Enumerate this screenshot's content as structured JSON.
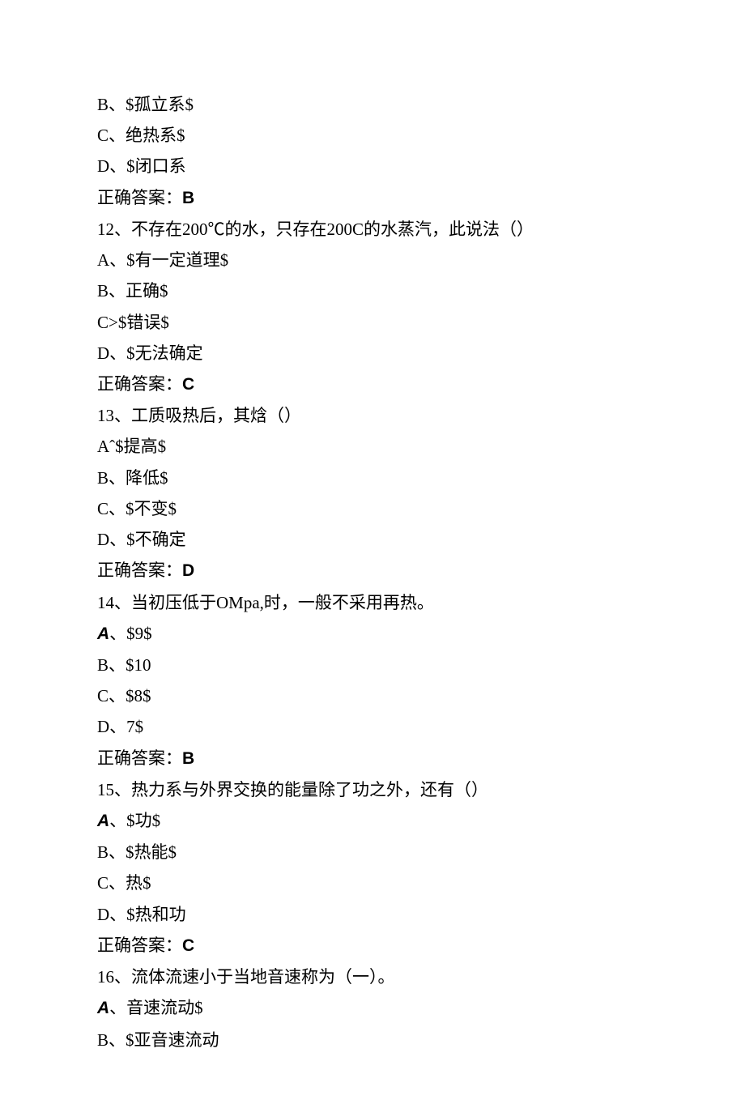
{
  "lines": [
    {
      "cls": "",
      "text": "B、$孤立系$"
    },
    {
      "cls": "",
      "text": "C、绝热系$"
    },
    {
      "cls": "",
      "text": "D、$闭口系"
    },
    {
      "cls": "",
      "prefix": "正确答案：",
      "boldClass": "bold",
      "bold": "B"
    },
    {
      "cls": "",
      "text": "12、不存在200℃的水，只存在200C的水蒸汽，此说法（）"
    },
    {
      "cls": "",
      "text": "A、$有一定道理$"
    },
    {
      "cls": "",
      "text": "B、正确$"
    },
    {
      "cls": "",
      "text": "C>$错误$"
    },
    {
      "cls": "",
      "text": "D、$无法确定"
    },
    {
      "cls": "",
      "prefix": "正确答案：",
      "boldClass": "bold",
      "bold": "C"
    },
    {
      "cls": "",
      "text": "13、工质吸热后，其焓（）"
    },
    {
      "cls": "",
      "text": "Aˆ$提高$"
    },
    {
      "cls": "",
      "text": "B、降低$"
    },
    {
      "cls": "",
      "text": "C、$不变$"
    },
    {
      "cls": "",
      "text": "D、$不确定"
    },
    {
      "cls": "",
      "prefix": "正确答案：",
      "boldClass": "bold",
      "bold": "D"
    },
    {
      "cls": "",
      "text": "14、当初压低于OMpa,时，一般不采用再热。"
    },
    {
      "cls": "",
      "boldPrefixClass": "italic-bold",
      "boldPrefix": "A",
      "text": "、$9$"
    },
    {
      "cls": "",
      "text": "B、$10"
    },
    {
      "cls": "",
      "text": "C、$8$"
    },
    {
      "cls": "",
      "text": "D、7$"
    },
    {
      "cls": "",
      "prefix": "正确答案：",
      "boldClass": "bold",
      "bold": "B"
    },
    {
      "cls": "",
      "text": "15、热力系与外界交换的能量除了功之外，还有（）"
    },
    {
      "cls": "",
      "boldPrefixClass": "italic-bold",
      "boldPrefix": "A",
      "text": "、$功$"
    },
    {
      "cls": "",
      "text": "B、$热能$"
    },
    {
      "cls": "",
      "text": "C、热$"
    },
    {
      "cls": "",
      "text": "D、$热和功"
    },
    {
      "cls": "",
      "prefix": "正确答案：",
      "boldClass": "bold",
      "bold": "C"
    },
    {
      "cls": "",
      "text": "16、流体流速小于当地音速称为（一）。"
    },
    {
      "cls": "",
      "boldPrefixClass": "italic-bold",
      "boldPrefix": "A",
      "text": "、音速流动$"
    },
    {
      "cls": "",
      "text": "B、$亚音速流动"
    }
  ]
}
